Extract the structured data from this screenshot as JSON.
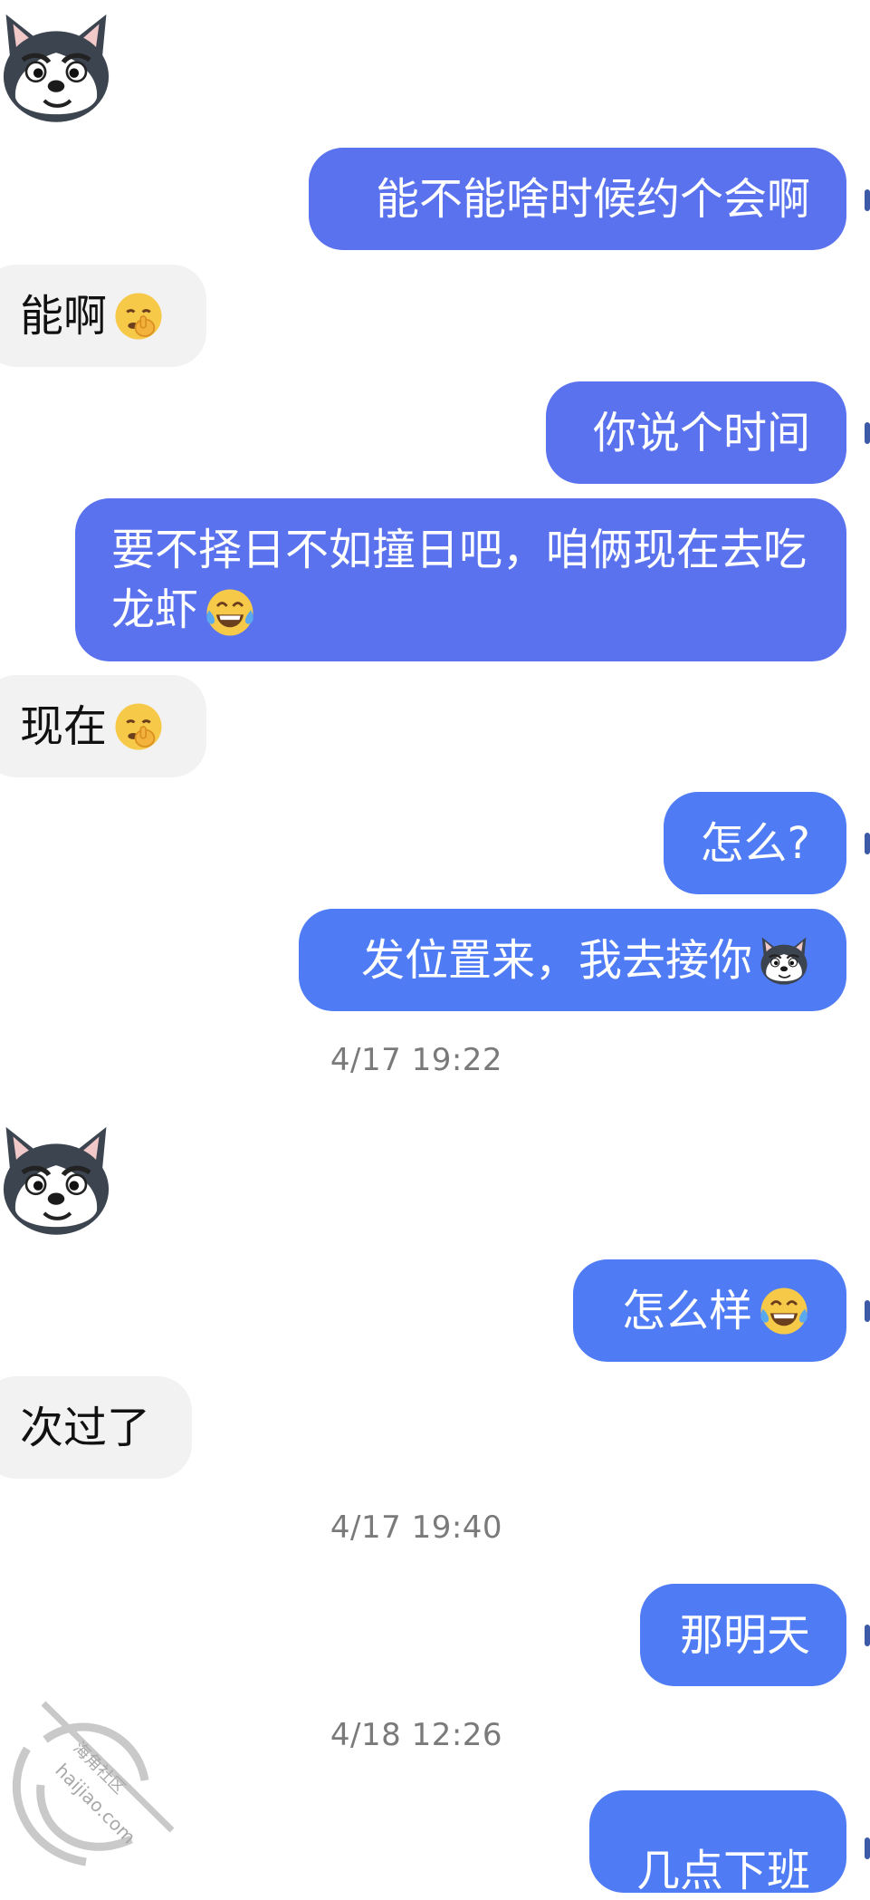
{
  "chat": {
    "messages": [
      {
        "side": "sent",
        "text": "能不能啥时候约个会啊"
      },
      {
        "side": "received",
        "text": "能啊",
        "emoji": "shushing-face-emoji"
      },
      {
        "side": "sent",
        "text": "你说个时间"
      },
      {
        "side": "sent",
        "text": "要不择日不如撞日吧，咱俩现在去吃龙虾",
        "emoji": "laughing-tears-emoji"
      },
      {
        "side": "received",
        "text": "现在",
        "emoji": "shushing-face-emoji"
      },
      {
        "side": "sent",
        "text": "怎么?"
      },
      {
        "side": "sent",
        "text": "发位置来，我去接你",
        "emoji": "husky-dog-emoji"
      },
      {
        "side": "sent",
        "text": "怎么样",
        "emoji": "laughing-tears-emoji"
      },
      {
        "side": "received",
        "text": "次过了"
      },
      {
        "side": "sent",
        "text": "那明天"
      },
      {
        "side": "sent",
        "text": "几点下班"
      }
    ],
    "timestamps": [
      "4/17 19:22",
      "4/17 19:40",
      "4/18 12:26"
    ],
    "sticker": "husky-dog-sticker"
  },
  "watermark": {
    "site": "haijiao.com",
    "name": "海角社区"
  },
  "colors": {
    "sent_bubble": "#4f7cf5",
    "received_bubble": "#f2f2f3",
    "timestamp_text": "#7a7a7a"
  }
}
